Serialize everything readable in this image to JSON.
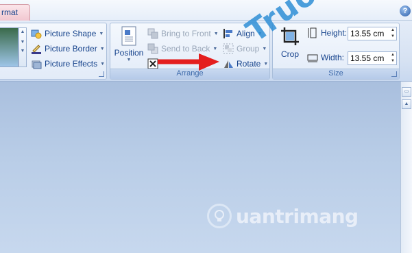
{
  "titlebar": {
    "tab_format": "rmat",
    "help": "?"
  },
  "ribbon": {
    "picture_styles": {
      "shape": "Picture Shape",
      "border": "Picture Border",
      "effects": "Picture Effects"
    },
    "arrange": {
      "label": "Arrange",
      "position": "Position",
      "bring_to_front": "Bring to Front",
      "send_to_back": "Send to Back",
      "align": "Align",
      "group": "Group",
      "rotate": "Rotate"
    },
    "size": {
      "label": "Size",
      "crop": "Crop",
      "height_label": "Height:",
      "height_value": "13.55 cm",
      "width_label": "Width:",
      "width_value": "13.55 cm"
    }
  },
  "watermark": {
    "site": "Truongthinh.online",
    "brand": "uantrimang"
  },
  "colors": {
    "arrow": "#e41e1e",
    "watermark": "#2f8fd6"
  }
}
